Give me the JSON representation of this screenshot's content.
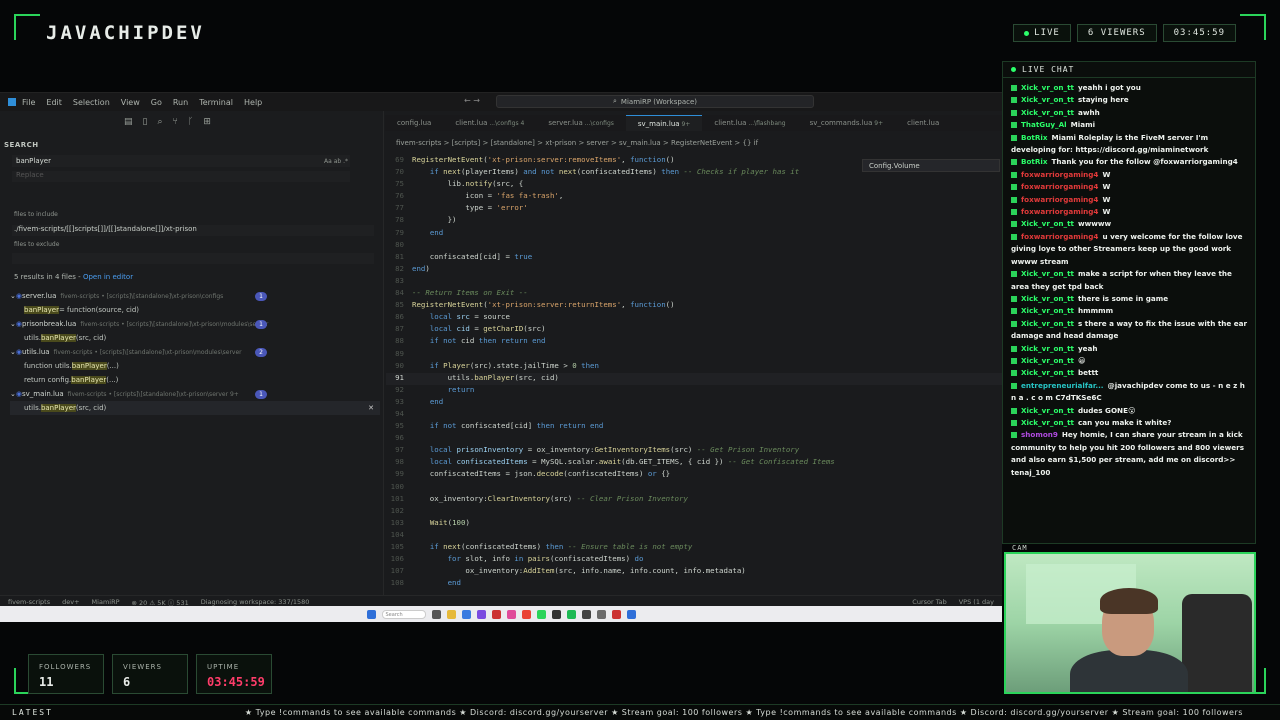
{
  "overlay": {
    "brand": "JAVACHIPDEV",
    "live": "LIVE",
    "viewers_badge": "6  VIEWERS",
    "clock": "03:45:59",
    "chat_title": "LIVE CHAT",
    "cam_label": "CAM",
    "latest_label": "LATEST",
    "ticker": "★ Type !commands to see available commands ★ Discord: discord.gg/yourserver ★ Stream goal: 100 followers ★ Type !commands to see available commands ★ Discord: discord.gg/yourserver ★ Stream goal: 100 followers",
    "accent_color": "#2bff6a"
  },
  "stats": [
    {
      "title": "FOLLOWERS",
      "value": "11"
    },
    {
      "title": "VIEWERS",
      "value": "6"
    },
    {
      "title": "UPTIME",
      "value": "03:45:59"
    }
  ],
  "vscode": {
    "menu": [
      "File",
      "Edit",
      "Selection",
      "View",
      "Go",
      "Run",
      "Terminal",
      "Help"
    ],
    "command_center": "MiamiRP (Workspace)",
    "search_title": "SEARCH",
    "search_value": "banPlayer",
    "search_opts": "Aa  ab  .*",
    "replace_placeholder": "Replace",
    "files_include_label": "files to include",
    "files_include_value": "./fivem-scripts/[[]scripts[]]/[[]standalone[]]/xt-prison",
    "files_exclude_label": "files to exclude",
    "results_summary": "5 results in 4 files - ",
    "open_in_editor": "Open in editor",
    "tree": [
      {
        "kind": "file",
        "name": "server.lua",
        "path": "fivem-scripts • [scripts]\\[standalone]\\xt-prison\\configs",
        "count": "1"
      },
      {
        "kind": "match",
        "pre": "",
        "hl": "banPlayer",
        "post": " = function(source, cid)"
      },
      {
        "kind": "file",
        "name": "prisonbreak.lua",
        "path": "fivem-scripts • [scripts]\\[standalone]\\xt-prison\\modules\\server",
        "count": "1"
      },
      {
        "kind": "match",
        "pre": "utils.",
        "hl": "banPlayer",
        "post": "(src, cid)"
      },
      {
        "kind": "file",
        "name": "utils.lua",
        "path": "fivem-scripts • [scripts]\\[standalone]\\xt-prison\\modules\\server",
        "count": "2"
      },
      {
        "kind": "match",
        "pre": "function utils.",
        "hl": "banPlayer",
        "post": "(...)"
      },
      {
        "kind": "match",
        "pre": "return config.",
        "hl": "banPlayer",
        "post": "(...)"
      },
      {
        "kind": "file",
        "name": "sv_main.lua",
        "path": "fivem-scripts • [scripts]\\[standalone]\\xt-prison\\server  9+",
        "count": "1"
      },
      {
        "kind": "match",
        "pre": "utils.",
        "hl": "banPlayer",
        "post": "(src, cid)",
        "selected": true
      }
    ],
    "tabs": [
      {
        "label": "config.lua",
        "mod": ""
      },
      {
        "label": "client.lua",
        "mod": " ...\\configs  4"
      },
      {
        "label": "server.lua",
        "mod": " ...\\configs"
      },
      {
        "label": "sv_main.lua",
        "mod": "  9+",
        "active": true
      },
      {
        "label": "client.lua",
        "mod": " ...\\flashbang"
      },
      {
        "label": "sv_commands.lua",
        "mod": "  9+"
      },
      {
        "label": "client.lua",
        "mod": ""
      }
    ],
    "breadcrumb": "fivem-scripts > [scripts] > [standalone] > xt-prison > server > sv_main.lua > RegisterNetEvent > {} if",
    "find_widget": "Config.Volume",
    "status_left": [
      "fivem-scripts",
      "dev+",
      "MiamiRP",
      "⊗ 20  ⚠ 5K  ⓘ 531",
      "Diagnosing workspace: 337/1580"
    ],
    "status_right": [
      "Cursor Tab",
      "VPS (1 day"
    ]
  },
  "code_lines": [
    {
      "n": "69",
      "html": "<span class='f'>RegisterNetEvent</span>(<span class='s'>'xt-prison:server:removeItems'</span>, <span class='k'>function</span>()"
    },
    {
      "n": "70",
      "html": "    <span class='k'>if</span> <span class='f'>next</span>(playerItems) <span class='k'>and not</span> <span class='f'>next</span>(confiscatedItems) <span class='k'>then</span> <span class='c'>-- Checks if player has it</span>"
    },
    {
      "n": "75",
      "html": "        lib.<span class='f'>notify</span>(src, {"
    },
    {
      "n": "76",
      "html": "            icon = <span class='s'>'fas fa-trash'</span>,"
    },
    {
      "n": "77",
      "html": "            type = <span class='s'>'error'</span>"
    },
    {
      "n": "78",
      "html": "        })"
    },
    {
      "n": "79",
      "html": "    <span class='k'>end</span>"
    },
    {
      "n": "80",
      "html": ""
    },
    {
      "n": "81",
      "html": "    confiscated[cid] = <span class='k'>true</span>"
    },
    {
      "n": "82",
      "html": "<span class='k'>end</span>)"
    },
    {
      "n": "83",
      "html": ""
    },
    {
      "n": "84",
      "html": "<span class='c'>-- Return Items on Exit --</span>"
    },
    {
      "n": "85",
      "html": "<span class='f'>RegisterNetEvent</span>(<span class='s'>'xt-prison:server:returnItems'</span>, <span class='k'>function</span>()"
    },
    {
      "n": "86",
      "html": "    <span class='k'>local</span> <span class='v'>src</span> = source"
    },
    {
      "n": "87",
      "html": "    <span class='k'>local</span> <span class='v'>cid</span> = <span class='f'>getCharID</span>(src)"
    },
    {
      "n": "88",
      "html": "    <span class='k'>if not</span> cid <span class='k'>then return end</span>"
    },
    {
      "n": "89",
      "html": ""
    },
    {
      "n": "90",
      "html": "    <span class='k'>if</span> <span class='f'>Player</span>(src).state.jailTime &gt; <span class='n'>0</span> <span class='k'>then</span>"
    },
    {
      "n": "91",
      "html": "        utils.<span class='f'>banPlayer</span>(src, cid)",
      "current": true
    },
    {
      "n": "92",
      "html": "        <span class='k'>return</span>"
    },
    {
      "n": "93",
      "html": "    <span class='k'>end</span>"
    },
    {
      "n": "94",
      "html": ""
    },
    {
      "n": "95",
      "html": "    <span class='k'>if not</span> confiscated[cid] <span class='k'>then return end</span>"
    },
    {
      "n": "96",
      "html": ""
    },
    {
      "n": "97",
      "html": "    <span class='k'>local</span> <span class='v'>prisonInventory</span> = ox_inventory:<span class='f'>GetInventoryItems</span>(src) <span class='c'>-- Get Prison Inventory</span>"
    },
    {
      "n": "98",
      "html": "    <span class='k'>local</span> <span class='v'>confiscatedItems</span> = MySQL.scalar.<span class='f'>await</span>(db.GET_ITEMS, { cid }) <span class='c'>-- Get Confiscated Items</span>"
    },
    {
      "n": "99",
      "html": "    confiscatedItems = json.<span class='f'>decode</span>(confiscatedItems) <span class='k'>or</span> {}"
    },
    {
      "n": "100",
      "html": ""
    },
    {
      "n": "101",
      "html": "    ox_inventory:<span class='f'>ClearInventory</span>(src) <span class='c'>-- Clear Prison Inventory</span>"
    },
    {
      "n": "102",
      "html": ""
    },
    {
      "n": "103",
      "html": "    <span class='f'>Wait</span>(<span class='n'>100</span>)"
    },
    {
      "n": "104",
      "html": ""
    },
    {
      "n": "105",
      "html": "    <span class='k'>if</span> <span class='f'>next</span>(confiscatedItems) <span class='k'>then</span> <span class='c'>-- Ensure table is not empty</span>"
    },
    {
      "n": "106",
      "html": "        <span class='k'>for</span> slot, info <span class='k'>in</span> <span class='f'>pairs</span>(confiscatedItems) <span class='k'>do</span>"
    },
    {
      "n": "107",
      "html": "            ox_inventory:<span class='f'>AddItem</span>(src, info.name, info.count, info.metadata)"
    },
    {
      "n": "108",
      "html": "        <span class='k'>end</span>"
    }
  ],
  "chat": [
    {
      "user": "Xick_vr_on_tt",
      "cls": "",
      "text": "yeahh i got you"
    },
    {
      "user": "Xick_vr_on_tt",
      "cls": "",
      "text": "staying here"
    },
    {
      "user": "Xick_vr_on_tt",
      "cls": "",
      "text": "awhh"
    },
    {
      "user": "ThatGuy_Al",
      "cls": "",
      "text": "Miami"
    },
    {
      "user": "BotRix",
      "cls": "bot",
      "text": "Miami Roleplay is the FiveM server I'm developing for: https://discord.gg/miaminetwork"
    },
    {
      "user": "BotRix",
      "cls": "bot",
      "text": "Thank you for the follow @foxwarriorgaming4"
    },
    {
      "user": "foxwarriorgaming4",
      "cls": "red",
      "text": "W"
    },
    {
      "user": "foxwarriorgaming4",
      "cls": "red",
      "text": "W"
    },
    {
      "user": "foxwarriorgaming4",
      "cls": "red",
      "text": "W"
    },
    {
      "user": "foxwarriorgaming4",
      "cls": "red",
      "text": "W"
    },
    {
      "user": "Xick_vr_on_tt",
      "cls": "",
      "text": "wwwww"
    },
    {
      "user": "foxwarriorgaming4",
      "cls": "red",
      "text": "u very welcome for the follow love giving loye to other Streamers keep up the good work wwww stream"
    },
    {
      "user": "Xick_vr_on_tt",
      "cls": "",
      "text": "make a script for when they leave the area they get tpd back"
    },
    {
      "user": "Xick_vr_on_tt",
      "cls": "",
      "text": "there is some in game"
    },
    {
      "user": "Xick_vr_on_tt",
      "cls": "",
      "text": "hmmmm"
    },
    {
      "user": "Xick_vr_on_tt",
      "cls": "",
      "text": "s there a way to fix the issue with the ear damage and head damage"
    },
    {
      "user": "Xick_vr_on_tt",
      "cls": "",
      "text": "yeah"
    },
    {
      "user": "Xick_vr_on_tt",
      "cls": "",
      "text": "😀"
    },
    {
      "user": "Xick_vr_on_tt",
      "cls": "",
      "text": "bettt"
    },
    {
      "user": "entrepreneurialfar...",
      "cls": "teal",
      "text": "@javachipdev come to us - n e z h n a . c o m C7dTKSe6C"
    },
    {
      "user": "Xick_vr_on_tt",
      "cls": "",
      "text": "dudes GONE😮"
    },
    {
      "user": "Xick_vr_on_tt",
      "cls": "",
      "text": "can you make it white?"
    },
    {
      "user": "shomon9",
      "cls": "pur",
      "text": "Hey homie, I can share your stream in a kick community to help you hit 200 followers and 800 viewers and also earn $1,500 per stream, add me on discord>> tenaj_100"
    }
  ]
}
